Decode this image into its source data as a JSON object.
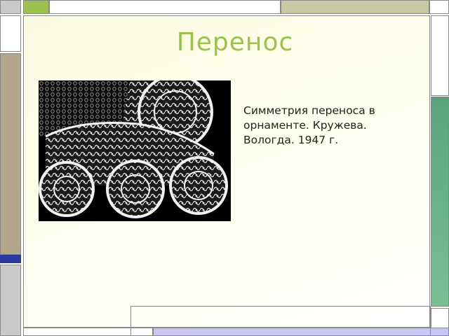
{
  "slide": {
    "title": "Перенос",
    "caption": "Симметрия переноса в\nорнаменте. Кружева.\nВологда. 1947 г."
  },
  "image": {
    "subject": "lace-ornament",
    "accent_color": "#9bc24f"
  },
  "decor_colors": {
    "green": "#9bc24f",
    "tan": "#b4a68a",
    "olive": "#c8c8a0",
    "gray": "#c8c8c8",
    "teal": "#5aa37c",
    "navy": "#2a3aa0",
    "lavender": "#c8c6f0"
  }
}
